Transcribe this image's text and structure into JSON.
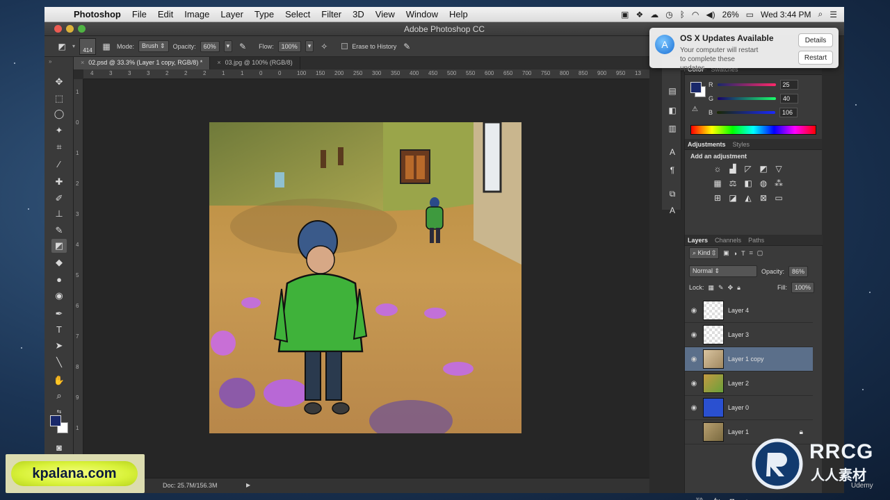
{
  "menubar": {
    "app_name": "Photoshop",
    "items": [
      "File",
      "Edit",
      "Image",
      "Layer",
      "Type",
      "Select",
      "Filter",
      "3D",
      "View",
      "Window",
      "Help"
    ],
    "battery": "26%",
    "clock": "Wed 3:44 PM"
  },
  "window": {
    "title": "Adobe Photoshop CC"
  },
  "options": {
    "brush_size": "414",
    "mode_label": "Mode:",
    "mode_value": "Brush",
    "opacity_label": "Opacity:",
    "opacity_value": "60%",
    "flow_label": "Flow:",
    "flow_value": "100%",
    "erase_history_label": "Erase to History"
  },
  "tabs": [
    {
      "label": "02.psd @ 33.3% (Layer 1 copy, RGB/8) *",
      "active": true
    },
    {
      "label": "03.jpg @ 100% (RGB/8)",
      "active": false
    }
  ],
  "ruler_h": [
    "4",
    "3",
    "3",
    "3",
    "2",
    "2",
    "2",
    "1",
    "1",
    "0",
    "0",
    "100",
    "150",
    "200",
    "250",
    "300",
    "350",
    "400",
    "450",
    "500",
    "550",
    "600",
    "650",
    "700",
    "750",
    "800",
    "850",
    "900",
    "950",
    "13"
  ],
  "ruler_v": [
    "1",
    "0",
    "1",
    "2",
    "3",
    "4",
    "5",
    "6",
    "7",
    "8",
    "9",
    "1",
    "1"
  ],
  "status": {
    "doc": "Doc: 25.7M/156.3M"
  },
  "notification": {
    "title": "OS X Updates Available",
    "body": "Your computer will restart to complete these updates.",
    "details_label": "Details",
    "restart_label": "Restart"
  },
  "color_panel": {
    "tabs": [
      "Color",
      "Swatches"
    ],
    "r_label": "R",
    "r_value": "25",
    "g_label": "G",
    "g_value": "40",
    "b_label": "B",
    "b_value": "106",
    "foreground": "#19286a"
  },
  "adjustments": {
    "tabs": [
      "Adjustments",
      "Styles"
    ],
    "heading": "Add an adjustment"
  },
  "layers_panel": {
    "tabs": [
      "Layers",
      "Channels",
      "Paths"
    ],
    "kind_label": "Kind",
    "blend_mode": "Normal",
    "opacity_label": "Opacity:",
    "opacity_value": "86%",
    "lock_label": "Lock:",
    "fill_label": "Fill:",
    "fill_value": "100%",
    "layers": [
      {
        "name": "Layer 4",
        "visible": true,
        "selected": false,
        "locked": false
      },
      {
        "name": "Layer 3",
        "visible": true,
        "selected": false,
        "locked": false
      },
      {
        "name": "Layer 1 copy",
        "visible": true,
        "selected": true,
        "locked": false
      },
      {
        "name": "Layer 2",
        "visible": true,
        "selected": false,
        "locked": false
      },
      {
        "name": "Layer 0",
        "visible": true,
        "selected": false,
        "locked": false
      },
      {
        "name": "Layer 1",
        "visible": false,
        "selected": false,
        "locked": true
      }
    ]
  },
  "watermarks": {
    "site": "kpalana.com",
    "brand": "RRCG",
    "brand_cn": "人人素材",
    "udemy": "Udemy"
  }
}
